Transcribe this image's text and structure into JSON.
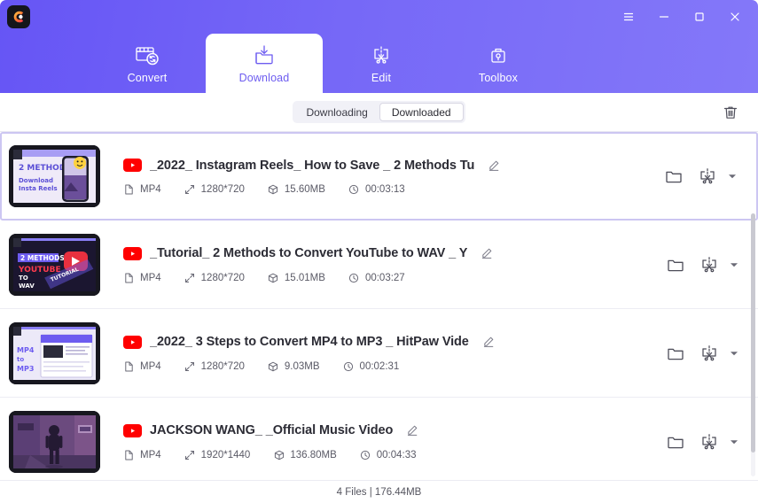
{
  "window": {
    "logo_icon": "hitpaw-logo-icon",
    "controls": [
      {
        "name": "menu-button",
        "icon": "hamburger-icon"
      },
      {
        "name": "minimize-button",
        "icon": "minimize-icon"
      },
      {
        "name": "maximize-button",
        "icon": "maximize-icon"
      },
      {
        "name": "close-button",
        "icon": "close-icon"
      }
    ],
    "accent_color": "#6d5cf0",
    "header_gradient_from": "#6655f5",
    "header_gradient_to": "#8478f9"
  },
  "tabs": [
    {
      "label": "Convert",
      "icon": "film-convert-icon",
      "active": false
    },
    {
      "label": "Download",
      "icon": "folder-download-icon",
      "active": true
    },
    {
      "label": "Edit",
      "icon": "scissors-crop-icon",
      "active": false
    },
    {
      "label": "Toolbox",
      "icon": "toolbox-icon",
      "active": false
    }
  ],
  "subtoolbar": {
    "segments": [
      {
        "label": "Downloading",
        "active": false
      },
      {
        "label": "Downloaded",
        "active": true
      }
    ],
    "clear_all_icon": "trash-icon"
  },
  "list": {
    "rows": [
      {
        "title": "_2022_ Instagram Reels_ How to Save _ 2 Methods Tu",
        "source_badge": "youtube-icon",
        "format": "MP4",
        "resolution": "1280*720",
        "size": "15.60MB",
        "duration": "00:03:13",
        "selected": true,
        "thumb": "instagram-reels-thumbnail",
        "thumb_text_1": "2 METHODS",
        "thumb_text_2": "Download",
        "thumb_text_3": "Insta Reels"
      },
      {
        "title": "_Tutorial_ 2 Methods to Convert YouTube to WAV _ Y",
        "source_badge": "youtube-icon",
        "format": "MP4",
        "resolution": "1280*720",
        "size": "15.01MB",
        "duration": "00:03:27",
        "selected": false,
        "thumb": "youtube-to-wav-thumbnail",
        "thumb_text_1": "2 METHODS",
        "thumb_text_2": "YOUTUBE",
        "thumb_text_3": "TO WAV"
      },
      {
        "title": "_2022_ 3 Steps to Convert MP4 to MP3 _ HitPaw Vide",
        "source_badge": "youtube-icon",
        "format": "MP4",
        "resolution": "1280*720",
        "size": "9.03MB",
        "duration": "00:02:31",
        "selected": false,
        "thumb": "mp4-to-mp3-thumbnail",
        "thumb_text_1": "MP4",
        "thumb_text_2": "to",
        "thumb_text_3": "MP3"
      },
      {
        "title": "JACKSON WANG_ _Official Music Video",
        "source_badge": "youtube-icon",
        "format": "MP4",
        "resolution": "1920*1440",
        "size": "136.80MB",
        "duration": "00:04:33",
        "selected": false,
        "thumb": "jackson-wang-thumbnail",
        "thumb_text_1": "",
        "thumb_text_2": "",
        "thumb_text_3": ""
      }
    ],
    "row_action_icons": {
      "open_folder": "folder-icon",
      "edit": "scissors-crop-icon",
      "more": "chevron-down-icon"
    }
  },
  "statusbar": {
    "summary": "4 Files | 176.44MB"
  }
}
